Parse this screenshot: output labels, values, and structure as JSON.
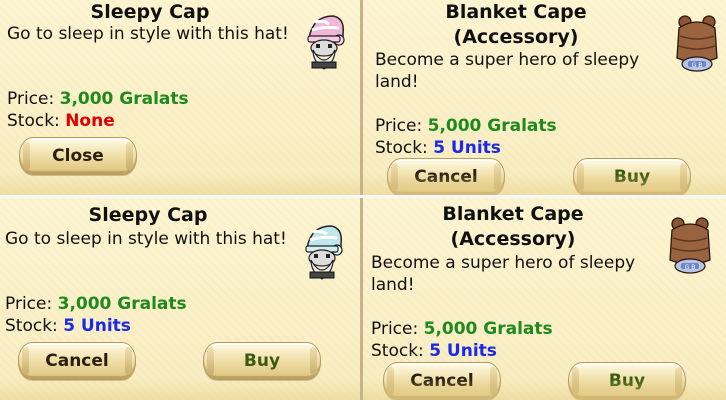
{
  "panels": {
    "tl": {
      "title": "Sleepy Cap",
      "desc": "Go to sleep in style with this hat!",
      "price_label": "Price: ",
      "price_value": "3,000 Gralats",
      "stock_label": "Stock: ",
      "stock_value": "None",
      "close_label": "Close",
      "item_icon": "sleepy-cap-pink-character-icon"
    },
    "tr": {
      "title_line1": "Blanket Cape",
      "title_line2": "(Accessory)",
      "desc": "Become a super hero of sleepy land!",
      "price_label": "Price: ",
      "price_value": "5,000 Gralats",
      "stock_label": "Stock: ",
      "stock_value": "5 Units",
      "cancel_label": "Cancel",
      "buy_label": "Buy",
      "item_icon": "blanket-cape-bear-icon"
    },
    "bl": {
      "title": "Sleepy Cap",
      "desc": "Go to sleep in style with this hat!",
      "price_label": "Price: ",
      "price_value": "3,000 Gralats",
      "stock_label": "Stock: ",
      "stock_value": "5 Units",
      "cancel_label": "Cancel",
      "buy_label": "Buy",
      "item_icon": "sleepy-cap-cyan-character-icon"
    },
    "br": {
      "title_line1": "Blanket Cape",
      "title_line2": "(Accessory)",
      "desc": "Become a super hero of sleepy land!",
      "price_label": "Price: ",
      "price_value": "5,000 Gralats",
      "stock_label": "Stock: ",
      "stock_value": "5 Units",
      "cancel_label": "Cancel",
      "buy_label": "Buy",
      "item_icon": "blanket-cape-bear-icon"
    }
  },
  "colors": {
    "price": "#1e8a1e",
    "stock_none": "#e00000",
    "stock_units": "#1a2ae6",
    "panel_bg": "#fbf1c9"
  }
}
